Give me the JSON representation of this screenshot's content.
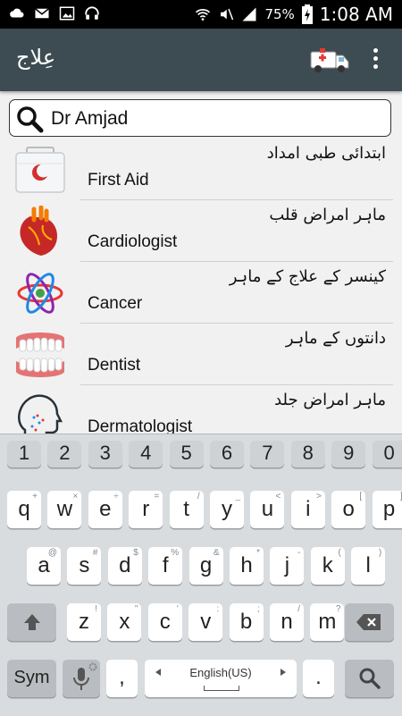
{
  "status_bar": {
    "battery": "75%",
    "time": "1:08 AM"
  },
  "app_bar": {
    "title": "عِلاج"
  },
  "search": {
    "value": "Dr Amjad"
  },
  "categories": [
    {
      "urdu": "ابتدائی طبی امداد",
      "english": "First Aid"
    },
    {
      "urdu": "ماہر امراض قلب",
      "english": "Cardiologist"
    },
    {
      "urdu": "کینسر کے علاج کے ماہر",
      "english": "Cancer"
    },
    {
      "urdu": "دانتوں کے ماہر",
      "english": "Dentist"
    },
    {
      "urdu": "ماہر امراض جلد",
      "english": "Dermatologist"
    }
  ],
  "keyboard": {
    "numbers": [
      "1",
      "2",
      "3",
      "4",
      "5",
      "6",
      "7",
      "8",
      "9",
      "0"
    ],
    "row1": [
      "q",
      "w",
      "e",
      "r",
      "t",
      "y",
      "u",
      "i",
      "o",
      "p"
    ],
    "row1_sub": [
      "+",
      "×",
      "÷",
      "=",
      "/",
      "_",
      "<",
      ">",
      "[",
      "]"
    ],
    "row2": [
      "a",
      "s",
      "d",
      "f",
      "g",
      "h",
      "j",
      "k",
      "l"
    ],
    "row2_sub": [
      "@",
      "#",
      "$",
      "%",
      "&",
      "*",
      "-",
      "(",
      ")"
    ],
    "row3": [
      "z",
      "x",
      "c",
      "v",
      "b",
      "n",
      "m"
    ],
    "row3_sub": [
      "!",
      "\"",
      "'",
      ":",
      ";",
      "/",
      "?"
    ],
    "sym_label": "Sym",
    "space_label": "English(US)",
    "period": ".",
    "comma": ","
  }
}
